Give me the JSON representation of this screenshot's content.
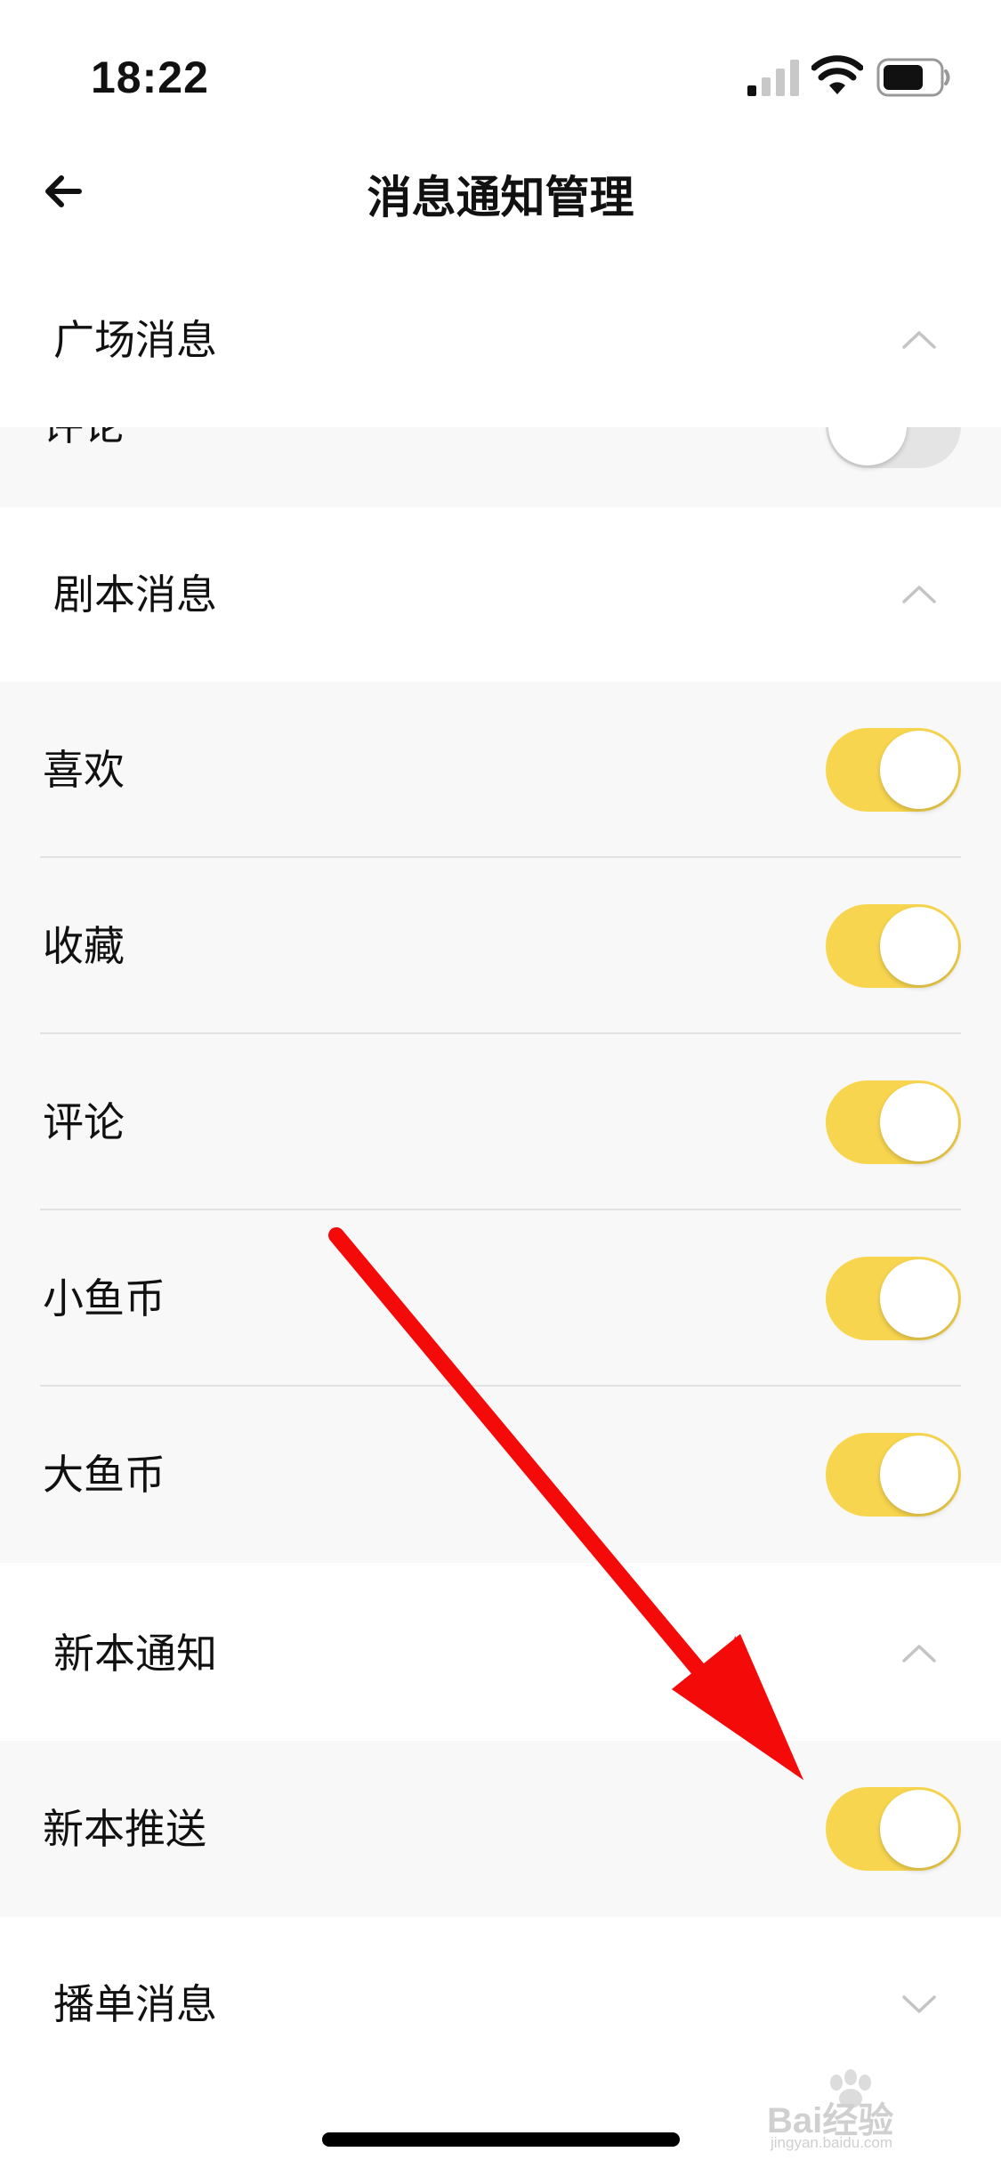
{
  "status_bar": {
    "time": "18:22",
    "signal_icon": "cellular-signal-icon",
    "wifi_icon": "wifi-icon",
    "battery_icon": "battery-icon"
  },
  "nav": {
    "title": "消息通知管理",
    "back_icon": "arrow-left-icon"
  },
  "sections": [
    {
      "title": "广场消息",
      "expanded": true,
      "chevron": "chevron-up-icon",
      "items": [
        {
          "label": "评论",
          "enabled": false,
          "partially_visible": true
        }
      ]
    },
    {
      "title": "剧本消息",
      "expanded": true,
      "chevron": "chevron-up-icon",
      "items": [
        {
          "label": "喜欢",
          "enabled": true
        },
        {
          "label": "收藏",
          "enabled": true
        },
        {
          "label": "评论",
          "enabled": true
        },
        {
          "label": "小鱼币",
          "enabled": true
        },
        {
          "label": "大鱼币",
          "enabled": true
        }
      ]
    },
    {
      "title": "新本通知",
      "expanded": true,
      "chevron": "chevron-up-icon",
      "items": [
        {
          "label": "新本推送",
          "enabled": true
        }
      ]
    },
    {
      "title": "播单消息",
      "expanded": false,
      "chevron": "chevron-down-icon",
      "items": []
    }
  ],
  "colors": {
    "toggle_on": "#f8d54f",
    "toggle_off": "#e4e4e4",
    "list_background": "#f8f8f8",
    "annotation_arrow": "#f50a0a"
  },
  "overlays": {
    "annotation_icon": "red-arrow-annotation-icon",
    "watermark_text": "Bai经验",
    "watermark_url": "jingyan.baidu.com"
  }
}
